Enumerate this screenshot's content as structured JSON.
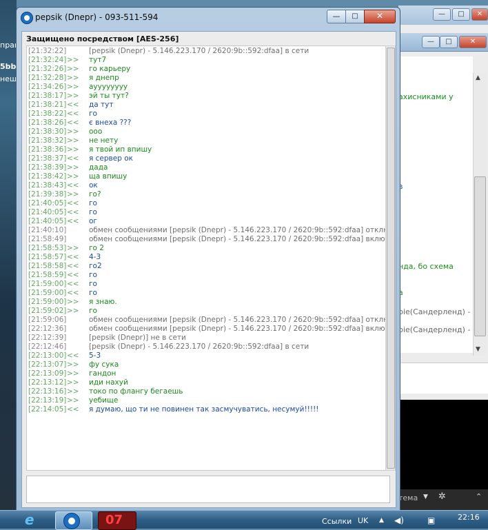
{
  "window": {
    "title": "pepsik (Dnepr) - 093-511-594",
    "minimize_symbol": "—",
    "maximize_symbol": "□",
    "close_symbol": "✕",
    "icon": "qip-flower-icon"
  },
  "encryption_label": "Защищено посредством [AES-256]",
  "log": [
    {
      "time": "[21:32:22]",
      "dir": "",
      "kind": "sys",
      "text": "[pepsik (Dnepr) - 5.146.223.170 / 2620:9b::592:dfaa] в сети"
    },
    {
      "time": "[21:32:24]",
      "dir": ">>",
      "kind": "out",
      "text": "тут7"
    },
    {
      "time": "[21:32:26]",
      "dir": ">>",
      "kind": "out",
      "text": "го карьеру"
    },
    {
      "time": "[21:32:28]",
      "dir": ">>",
      "kind": "out",
      "text": "я днепр"
    },
    {
      "time": "[21:34:26]",
      "dir": ">>",
      "kind": "out",
      "text": "ауууууууу"
    },
    {
      "time": "[21:38:17]",
      "dir": ">>",
      "kind": "out",
      "text": "эй ты тут?"
    },
    {
      "time": "[21:38:21]",
      "dir": "<<",
      "kind": "in",
      "text": "да тут"
    },
    {
      "time": "[21:38:22]",
      "dir": "<<",
      "kind": "in",
      "text": "го"
    },
    {
      "time": "[21:38:26]",
      "dir": "<<",
      "kind": "in",
      "text": "є внеха ???"
    },
    {
      "time": "[21:38:30]",
      "dir": ">>",
      "kind": "out",
      "text": "ооо"
    },
    {
      "time": "[21:38:32]",
      "dir": ">>",
      "kind": "out",
      "text": "не нету"
    },
    {
      "time": "[21:38:36]",
      "dir": ">>",
      "kind": "out",
      "text": "я твой ип впишу"
    },
    {
      "time": "[21:38:37]",
      "dir": "<<",
      "kind": "in",
      "text": "я сервер ок"
    },
    {
      "time": "[21:38:39]",
      "dir": ">>",
      "kind": "out",
      "text": "дада"
    },
    {
      "time": "[21:38:42]",
      "dir": ">>",
      "kind": "out",
      "text": "ща впишу"
    },
    {
      "time": "[21:38:43]",
      "dir": "<<",
      "kind": "in",
      "text": "ок"
    },
    {
      "time": "[21:39:38]",
      "dir": ">>",
      "kind": "out",
      "text": "го?"
    },
    {
      "time": "[21:40:05]",
      "dir": "<<",
      "kind": "in",
      "text": "го"
    },
    {
      "time": "[21:40:05]",
      "dir": "<<",
      "kind": "in",
      "text": "го"
    },
    {
      "time": "[21:40:05]",
      "dir": "<<",
      "kind": "in",
      "text": "ог"
    },
    {
      "time": "[21:40:10]",
      "dir": "",
      "kind": "sys",
      "text": "обмен сообщениями [pepsik (Dnepr) - 5.146.223.170 / 2620:9b::592:dfaa] отключен"
    },
    {
      "time": "[21:58:49]",
      "dir": "",
      "kind": "sys",
      "text": "обмен сообщениями [pepsik (Dnepr) - 5.146.223.170 / 2620:9b::592:dfaa] включен"
    },
    {
      "time": "[21:58:53]",
      "dir": ">>",
      "kind": "out",
      "text": "го 2"
    },
    {
      "time": "[21:58:57]",
      "dir": "<<",
      "kind": "in",
      "text": "4-3"
    },
    {
      "time": "[21:58:58]",
      "dir": "<<",
      "kind": "in",
      "text": "го2"
    },
    {
      "time": "[21:58:59]",
      "dir": "<<",
      "kind": "in",
      "text": "го"
    },
    {
      "time": "[21:59:00]",
      "dir": "<<",
      "kind": "in",
      "text": "го"
    },
    {
      "time": "[21:59:00]",
      "dir": "<<",
      "kind": "in",
      "text": "го"
    },
    {
      "time": "[21:59:00]",
      "dir": ">>",
      "kind": "out",
      "text": "я знаю."
    },
    {
      "time": "[21:59:02]",
      "dir": ">>",
      "kind": "out",
      "text": "го"
    },
    {
      "time": "[21:59:06]",
      "dir": "",
      "kind": "sys",
      "text": "обмен сообщениями [pepsik (Dnepr) - 5.146.223.170 / 2620:9b::592:dfaa] отключен"
    },
    {
      "time": "[22:12:36]",
      "dir": "",
      "kind": "sys",
      "text": "обмен сообщениями [pepsik (Dnepr) - 5.146.223.170 / 2620:9b::592:dfaa] включен"
    },
    {
      "time": "[22:12:39]",
      "dir": "",
      "kind": "sys",
      "text": "[pepsik (Dnepr)] не в сети"
    },
    {
      "time": "[22:12:46]",
      "dir": "",
      "kind": "sys",
      "text": "[pepsik (Dnepr) - 5.146.223.170 / 2620:9b::592:dfaa] в сети"
    },
    {
      "time": "[22:13:00]",
      "dir": "<<",
      "kind": "in",
      "text": "5-3"
    },
    {
      "time": "[22:13:07]",
      "dir": ">>",
      "kind": "out",
      "text": "фу сука"
    },
    {
      "time": "[22:13:09]",
      "dir": ">>",
      "kind": "out",
      "text": "гандон"
    },
    {
      "time": "[22:13:12]",
      "dir": ">>",
      "kind": "out",
      "text": "иди нахуй"
    },
    {
      "time": "[22:13:16]",
      "dir": ">>",
      "kind": "out",
      "text": "токо по флангу бегаешь"
    },
    {
      "time": "[22:13:19]",
      "dir": ">>",
      "kind": "out",
      "text": "уебище"
    },
    {
      "time": "[22:14:05]",
      "dir": "<<",
      "kind": "in",
      "text": "я думаю, що ти не повинен так засмучуватись, несумуй!!!!!"
    }
  ],
  "input_value": "",
  "background": {
    "left_fragments": [
      "прав",
      "5bb",
      "неш"
    ],
    "right_fragments": [
      {
        "text": "ахисниками у",
        "color": "green"
      },
      {
        "text": "в",
        "color": "blue"
      },
      {
        "text": "нда, бо схема",
        "color": "green"
      },
      {
        "text": "а",
        "color": "green"
      },
      {
        "text": "bie(Сандерленд) -",
        "color": "grey"
      },
      {
        "text": "bie(Сандерленд) -",
        "color": "grey"
      },
      {
        "text": "тема",
        "color": "grey"
      }
    ]
  },
  "taskbar": {
    "app_07_label": "07",
    "links_label": "Ссылки",
    "language": "UK",
    "clock_time": "22:16"
  },
  "colors": {
    "outgoing": "#1a8a1a",
    "incoming": "#1a4aa8",
    "system": "#6e6e6e",
    "timestamp": "#62a862"
  }
}
